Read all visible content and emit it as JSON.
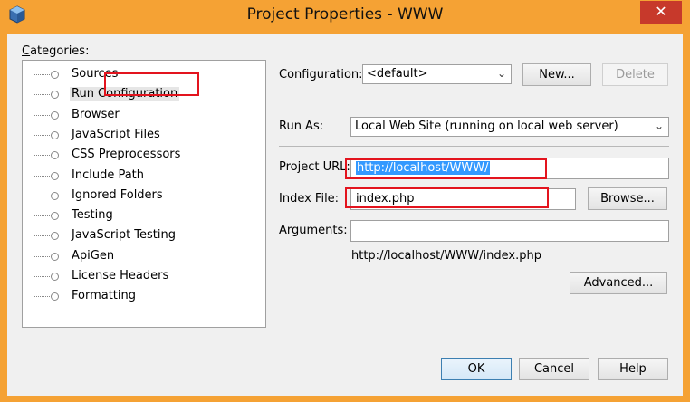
{
  "window": {
    "title": "Project Properties - WWW",
    "close_glyph": "✕",
    "app_icon": "netbeans-cube-icon"
  },
  "categories": {
    "label": "Categories:",
    "items": [
      {
        "label": "Sources"
      },
      {
        "label": "Run Configuration",
        "selected": true
      },
      {
        "label": "Browser"
      },
      {
        "label": "JavaScript Files"
      },
      {
        "label": "CSS Preprocessors"
      },
      {
        "label": "Include Path"
      },
      {
        "label": "Ignored Folders"
      },
      {
        "label": "Testing"
      },
      {
        "label": "JavaScript Testing"
      },
      {
        "label": "ApiGen"
      },
      {
        "label": "License Headers"
      },
      {
        "label": "Formatting"
      }
    ]
  },
  "config": {
    "label": "Configuration:",
    "value": "<default>",
    "new_label": "New...",
    "delete_label": "Delete"
  },
  "run_as": {
    "label": "Run As:",
    "value": "Local Web Site (running on local web server)"
  },
  "project_url": {
    "label": "Project URL:",
    "value": "http://localhost/WWW/"
  },
  "index_file": {
    "label": "Index File:",
    "value": "index.php",
    "browse_label": "Browse..."
  },
  "arguments": {
    "label": "Arguments:",
    "value": ""
  },
  "resolved_url": "http://localhost/WWW/index.php",
  "advanced_label": "Advanced...",
  "footer": {
    "ok_label": "OK",
    "cancel_label": "Cancel",
    "help_label": "Help"
  },
  "colors": {
    "titlebar": "#f5a234",
    "close_button": "#c7392b",
    "highlight_box": "#e3141e",
    "selection": "#3399ff"
  }
}
